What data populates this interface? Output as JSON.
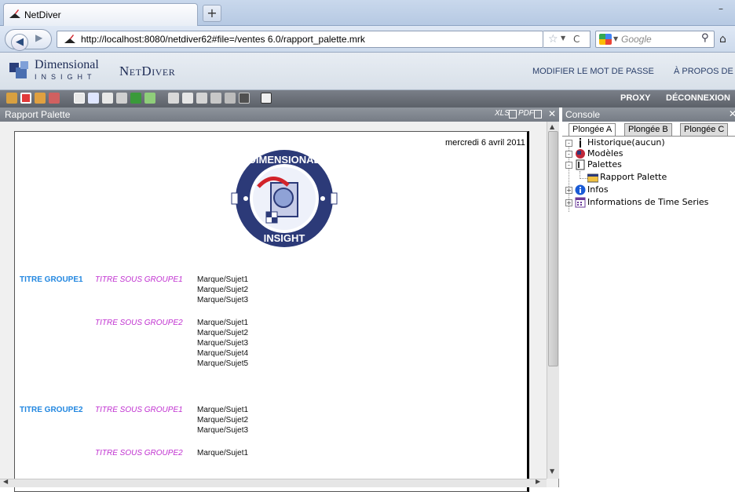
{
  "browser": {
    "tab_title": "NetDiver",
    "new_tab_symbol": "+",
    "url": "http://localhost:8080/netdiver62#file=/ventes 6.0/rapport_palette.mrk",
    "search_placeholder": "Google",
    "icons": [
      "netdiver-favicon",
      "back-arrow-icon",
      "forward-arrow-icon",
      "star-icon",
      "reload-icon",
      "search-icon",
      "home-icon"
    ]
  },
  "header": {
    "brand_line1": "Dimensional",
    "brand_line2": "INSIGHT",
    "product": "NetDiver",
    "links": {
      "change_password": "MODIFIER LE MOT DE PASSE",
      "about": "À PROPOS DE"
    }
  },
  "toolbar": {
    "proxy": "PROXY",
    "logout": "DÉCONNEXION"
  },
  "left_panel": {
    "title": "Rapport Palette",
    "export_xls": "XLS",
    "export_pdf": "PDF",
    "close": "✕",
    "report": {
      "date": "mercredi 6 avril 2011",
      "groups": [
        {
          "title": "TITRE GROUPE1",
          "subgroups": [
            {
              "title": "TITRE SOUS GROUPE1",
              "items": [
                "Marque/Sujet1",
                "Marque/Sujet2",
                "Marque/Sujet3"
              ]
            },
            {
              "title": "TITRE SOUS GROUPE2",
              "items": [
                "Marque/Sujet1",
                "Marque/Sujet2",
                "Marque/Sujet3",
                "Marque/Sujet4",
                "Marque/Sujet5"
              ]
            }
          ]
        },
        {
          "title": "TITRE GROUPE2",
          "subgroups": [
            {
              "title": "TITRE SOUS GROUPE1",
              "items": [
                "Marque/Sujet1",
                "Marque/Sujet2",
                "Marque/Sujet3"
              ]
            },
            {
              "title": "TITRE SOUS GROUPE2",
              "items": [
                "Marque/Sujet1"
              ]
            }
          ]
        }
      ]
    }
  },
  "right_panel": {
    "title": "Console",
    "close": "✕",
    "tabs": [
      "Plongée A",
      "Plongée B",
      "Plongée C"
    ],
    "active_tab": "Plongée A",
    "tree": {
      "historique": "Historique(aucun)",
      "modeles": "Modèles",
      "palettes": "Palettes",
      "rapport_palette": "Rapport Palette",
      "infos": "Infos",
      "time_series": "Informations de Time Series"
    }
  },
  "colors": {
    "group_title": "#2287e0",
    "subgroup_title": "#c030d0",
    "brand": "#1d2b55",
    "toolbar_bg": "#666b73"
  }
}
